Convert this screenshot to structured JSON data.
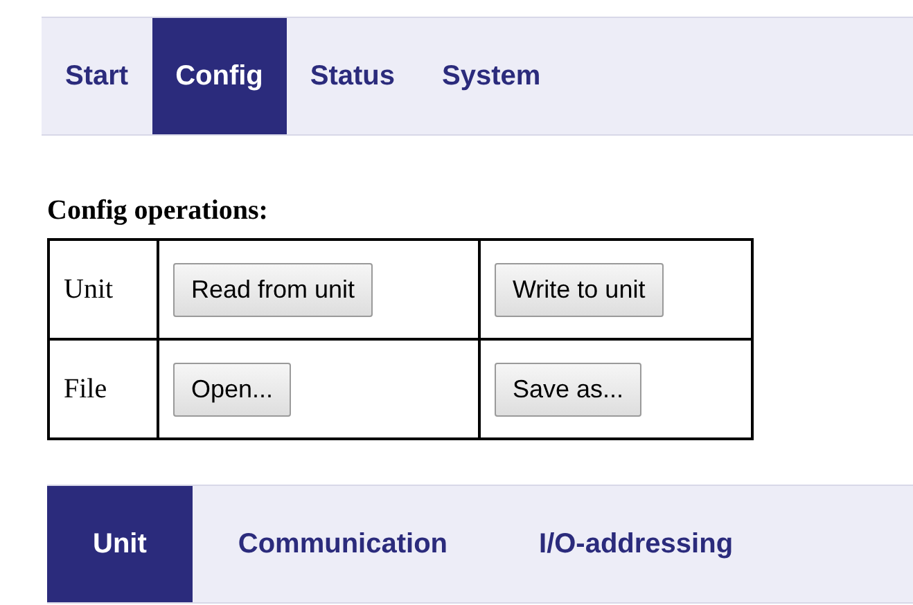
{
  "main_tabs": [
    {
      "label": "Start",
      "selected": false
    },
    {
      "label": "Config",
      "selected": true
    },
    {
      "label": "Status",
      "selected": false
    },
    {
      "label": "System",
      "selected": false
    }
  ],
  "section_title": "Config operations:",
  "operations": [
    {
      "label": "Unit",
      "buttons": [
        "Read from unit",
        "Write to unit"
      ]
    },
    {
      "label": "File",
      "buttons": [
        "Open...",
        "Save as..."
      ]
    }
  ],
  "sub_tabs": [
    {
      "label": "Unit",
      "selected": true
    },
    {
      "label": "Communication",
      "selected": false
    },
    {
      "label": "I/O-addressing",
      "selected": false
    }
  ]
}
